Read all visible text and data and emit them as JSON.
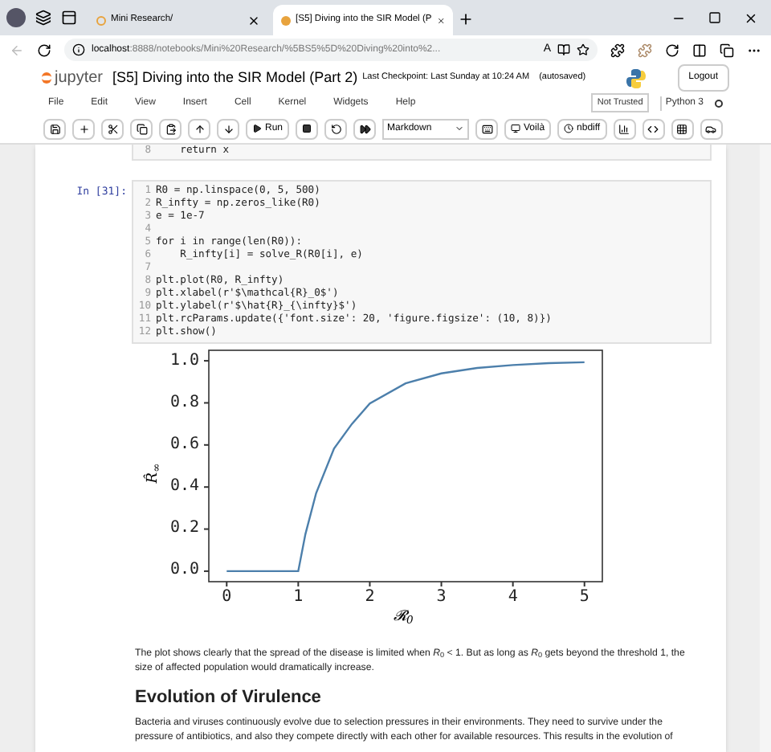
{
  "browser": {
    "tabs": [
      {
        "title": "Mini Research/",
        "selected": false
      },
      {
        "title": "[S5] Diving into the SIR Model (P",
        "selected": true
      }
    ],
    "url_host": "localhost",
    "url_path": ":8888/notebooks/Mini%20Research/%5BS5%5D%20Diving%20into%2...",
    "read_aloud": "A"
  },
  "notebook": {
    "brand": "jupyter",
    "title": "[S5] Diving into the SIR Model (Part 2)",
    "checkpoint": "Last Checkpoint: Last Sunday at 10:24 AM",
    "autosave": "(autosaved)",
    "logout": "Logout",
    "menu": [
      "File",
      "Edit",
      "View",
      "Insert",
      "Cell",
      "Kernel",
      "Widgets",
      "Help"
    ],
    "trust": "Not Trusted",
    "kernel": "Python 3",
    "toolbar": {
      "run": "Run",
      "cell_type": "Markdown",
      "voila": "Voilà",
      "nbdiff": "nbdiff"
    }
  },
  "prev_cell": {
    "lines": [
      {
        "number": "8",
        "code": "    return x"
      }
    ]
  },
  "cell": {
    "prompt": "In [31]:",
    "lines": [
      {
        "number": "1",
        "code": "R0 = np.linspace(0, 5, 500)"
      },
      {
        "number": "2",
        "code": "R_infty = np.zeros_like(R0)"
      },
      {
        "number": "3",
        "code": "e = 1e-7"
      },
      {
        "number": "4"
      },
      {
        "number": "5",
        "code": "for i in range(len(R0)):"
      },
      {
        "number": "6",
        "code": "    R_infty[i] = solve_R(R0[i], e)"
      },
      {
        "number": "7"
      },
      {
        "number": "8",
        "code": "plt.plot(R0, R_infty)"
      },
      {
        "number": "9",
        "code": "plt.xlabel(r'$\\mathcal{R}_0$')"
      },
      {
        "number": "10",
        "code": "plt.ylabel(r'$\\hat{R}_{\\infty}$')"
      },
      {
        "number": "11",
        "code": "plt.rcParams.update({'font.size': 20, 'figure.figsize': (10, 8)})"
      },
      {
        "number": "12",
        "code": "plt.show()"
      }
    ]
  },
  "output": {
    "chart_data": {
      "type": "line",
      "xlabel": "𝓡$_{0}$",
      "ylabel": "R̂$_{∞}$",
      "x": [
        0,
        0.5,
        1,
        1.1,
        1.25,
        1.5,
        1.75,
        2,
        2.5,
        3,
        3.5,
        4,
        4.5,
        5
      ],
      "series": [
        {
          "color": "#4c7fab",
          "values": [
            0,
            0,
            0,
            0.176,
            0.371,
            0.583,
            0.7,
            0.797,
            0.893,
            0.94,
            0.966,
            0.98,
            0.989,
            0.993
          ]
        }
      ],
      "xlim": [
        -0.25,
        5.25
      ],
      "ylim": [
        -0.05,
        1.05
      ],
      "xticks": [
        {
          "value": 0,
          "label": "0"
        },
        {
          "value": 1,
          "label": "1"
        },
        {
          "value": 2,
          "label": "2"
        },
        {
          "value": 3,
          "label": "3"
        },
        {
          "value": 4,
          "label": "4"
        },
        {
          "value": 5,
          "label": "5"
        }
      ],
      "yticks": [
        {
          "value": 0,
          "label": "0.0"
        },
        {
          "value": 0.2,
          "label": "0.2"
        },
        {
          "value": 0.4,
          "label": "0.4"
        },
        {
          "value": 0.6,
          "label": "0.6"
        },
        {
          "value": 0.8,
          "label": "0.8"
        },
        {
          "value": 1,
          "label": "1.0"
        }
      ]
    }
  },
  "markdown": {
    "paragraph": "The plot shows clearly that the spread of the disease is limited when *R*$_{0}$ < 1. But as long as *R*$_{0}$ gets beyond the threshold 1, the size of affected population would dramatically increase.",
    "heading": "Evolution of Virulence",
    "paragraph2": "Bacteria and viruses continuously evolve due to selection pressures in their environments. They need to survive under the pressure of antibiotics, and also they compete directly with each other for available resources. This results in the evolution of"
  }
}
